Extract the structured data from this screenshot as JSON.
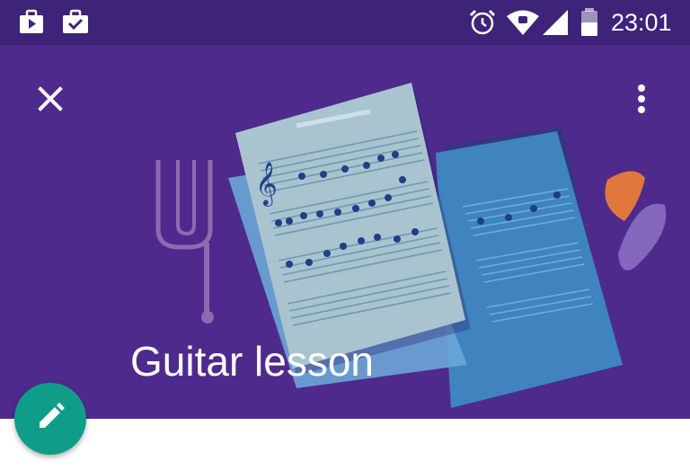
{
  "status_bar": {
    "time": "23:01",
    "left_icons": [
      "play-store-briefcase-icon",
      "work-briefcase-check-icon"
    ],
    "right_icons": [
      "alarm-icon",
      "wifi-icon",
      "cellular-signal-icon",
      "battery-icon"
    ],
    "background": "#3d2478"
  },
  "header": {
    "title": "Guitar lesson",
    "background": "#4f2a8d",
    "illustration": [
      "tuning-fork",
      "sheet-music",
      "guitar-picks"
    ]
  },
  "toolbar": {
    "close_icon": "close-icon",
    "menu_icon": "more-vert-icon"
  },
  "fab": {
    "icon": "edit-pencil-icon",
    "color": "#0f9d8a"
  }
}
